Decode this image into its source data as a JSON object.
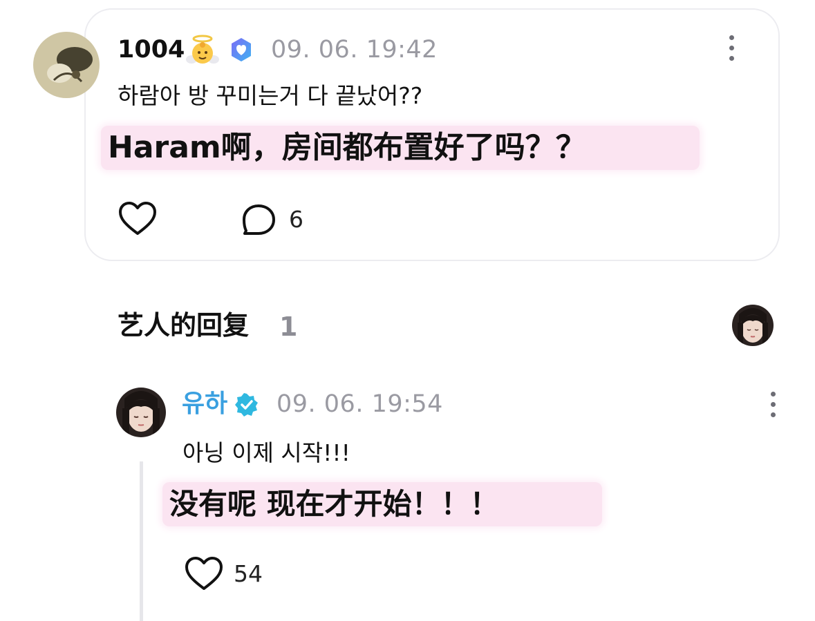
{
  "comment": {
    "author": "1004",
    "author_emoji": "baby-angel-icon",
    "badge": "verified-fan-icon",
    "timestamp": "09. 06. 19:42",
    "text": "하람아 방 꾸미는거 다 끝났어??",
    "translation": "Haram啊，房间都布置好了吗？？",
    "likes_label": "",
    "reply_count": "6"
  },
  "artist_replies": {
    "title": "艺人的回复",
    "count": "1"
  },
  "reply": {
    "author": "유하",
    "badge": "verified-artist-icon",
    "timestamp": "09. 06. 19:54",
    "text": "아닝 이제 시작!!!",
    "translation": "没有呢 现在才开始！！！",
    "likes": "54"
  },
  "colors": {
    "accent": "#3aa0e0",
    "muted": "#9a9aa2",
    "highlight": "#fbe4f1",
    "card_border": "#ececf0"
  }
}
